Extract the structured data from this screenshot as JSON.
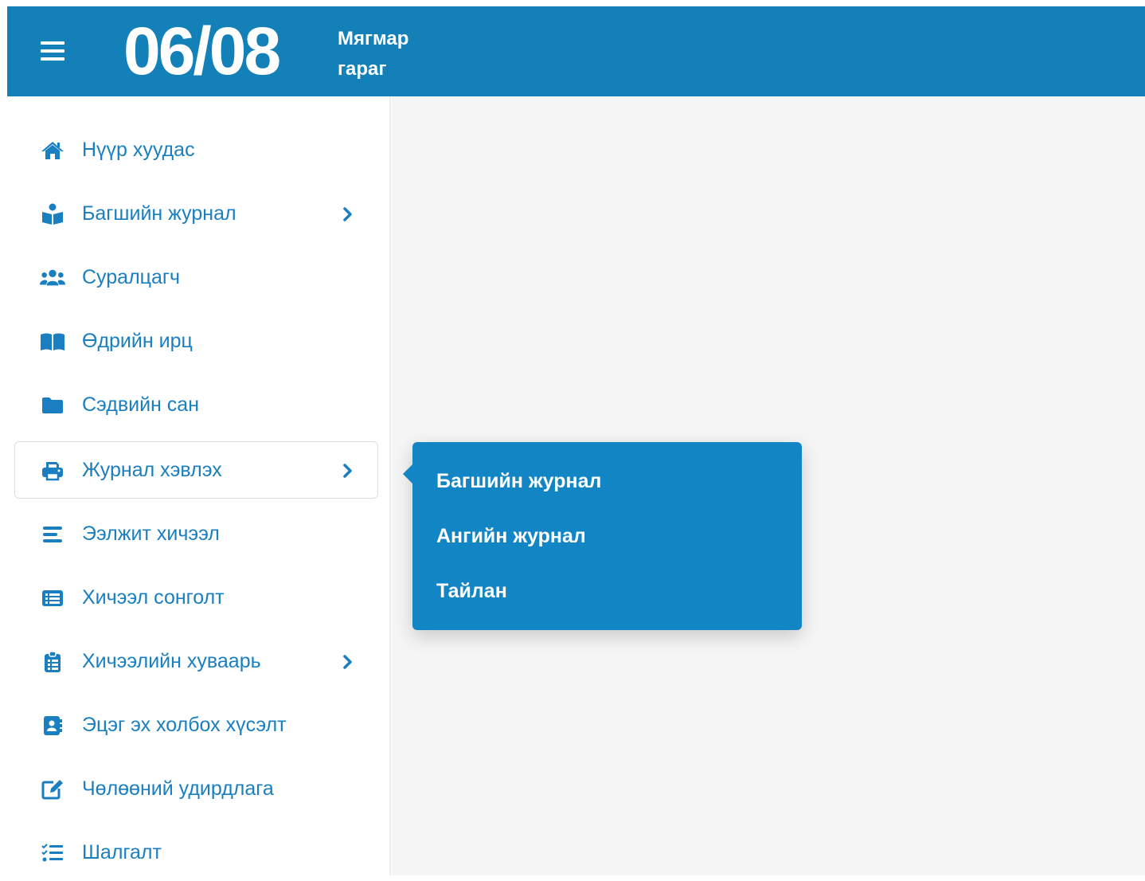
{
  "header": {
    "date": "06/08",
    "day_line1": "Мягмар",
    "day_line2": "гараг",
    "background_color": "#1380b8"
  },
  "sidebar": {
    "accent_color": "#1a7fc0",
    "items": [
      {
        "label": "Нүүр хуудас",
        "icon": "home-icon",
        "has_submenu": false
      },
      {
        "label": "Багшийн журнал",
        "icon": "teacher-icon",
        "has_submenu": true
      },
      {
        "label": "Суралцагч",
        "icon": "users-icon",
        "has_submenu": false
      },
      {
        "label": "Өдрийн ирц",
        "icon": "book-open-icon",
        "has_submenu": false
      },
      {
        "label": "Сэдвийн сан",
        "icon": "folder-icon",
        "has_submenu": false
      },
      {
        "label": "Журнал хэвлэх",
        "icon": "printer-icon",
        "has_submenu": true,
        "active": true
      },
      {
        "label": "Ээлжит хичээл",
        "icon": "align-lines-icon",
        "has_submenu": false
      },
      {
        "label": "Хичээл сонголт",
        "icon": "list-box-icon",
        "has_submenu": false
      },
      {
        "label": "Хичээлийн хуваарь",
        "icon": "clipboard-list-icon",
        "has_submenu": true
      },
      {
        "label": "Эцэг эх холбох хүсэлт",
        "icon": "address-book-icon",
        "has_submenu": false
      },
      {
        "label": "Чөлөөний удирдлага",
        "icon": "edit-icon",
        "has_submenu": false
      },
      {
        "label": "Шалгалт",
        "icon": "checklist-icon",
        "has_submenu": false
      }
    ]
  },
  "popup": {
    "background_color": "#1285c4",
    "items": [
      {
        "label": "Багшийн журнал"
      },
      {
        "label": "Ангийн журнал"
      },
      {
        "label": "Тайлан"
      }
    ]
  }
}
